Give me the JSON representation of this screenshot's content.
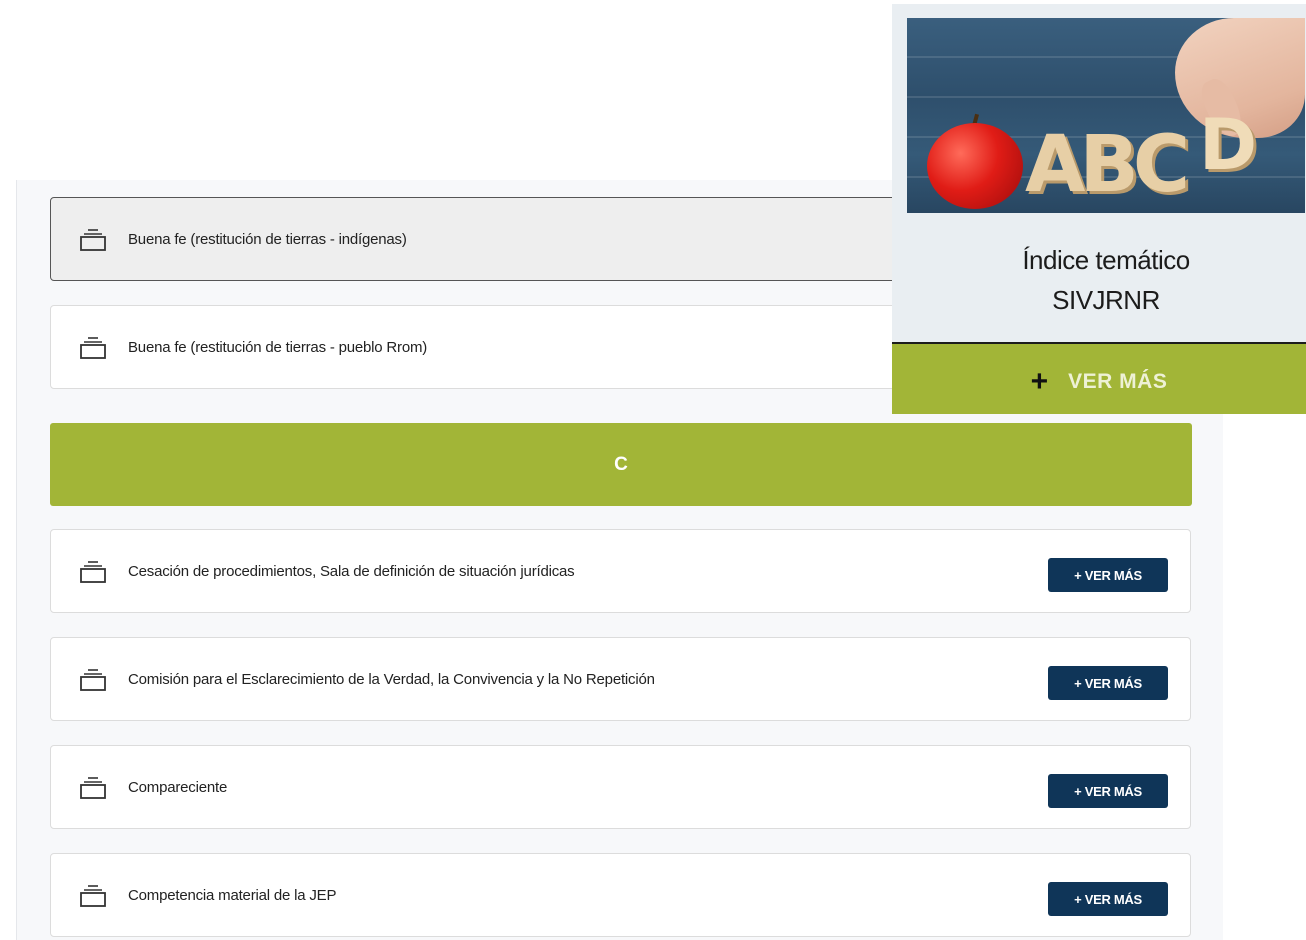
{
  "letter_section": {
    "letter": "C"
  },
  "rows": [
    {
      "label": "Buena fe (restitución de tierras - indígenas)",
      "button": ""
    },
    {
      "label": "Buena fe (restitución de tierras - pueblo Rrom)",
      "button": ""
    },
    {
      "label": "Cesación de procedimientos, Sala de definición de situación jurídicas",
      "button": "+ VER MÁS"
    },
    {
      "label": "Comisión para el Esclarecimiento de la Verdad, la Convivencia y la No Repetición",
      "button": "+ VER MÁS"
    },
    {
      "label": "Compareciente",
      "button": "+ VER MÁS"
    },
    {
      "label": "Competencia material de la JEP",
      "button": "+ VER MÁS"
    }
  ],
  "card": {
    "image_letters": "ABC",
    "image_letter_extra": "D",
    "title_line1": "Índice temático",
    "title_line2": "SIVJRNR",
    "footer_plus": "+",
    "footer_label": "VER MÁS"
  },
  "colors": {
    "accent_green": "#a2b537",
    "button_navy": "#0f3558"
  },
  "icons": {
    "row_icon": "layers-stack-icon",
    "image": "apple-abc-blocks-photo"
  }
}
